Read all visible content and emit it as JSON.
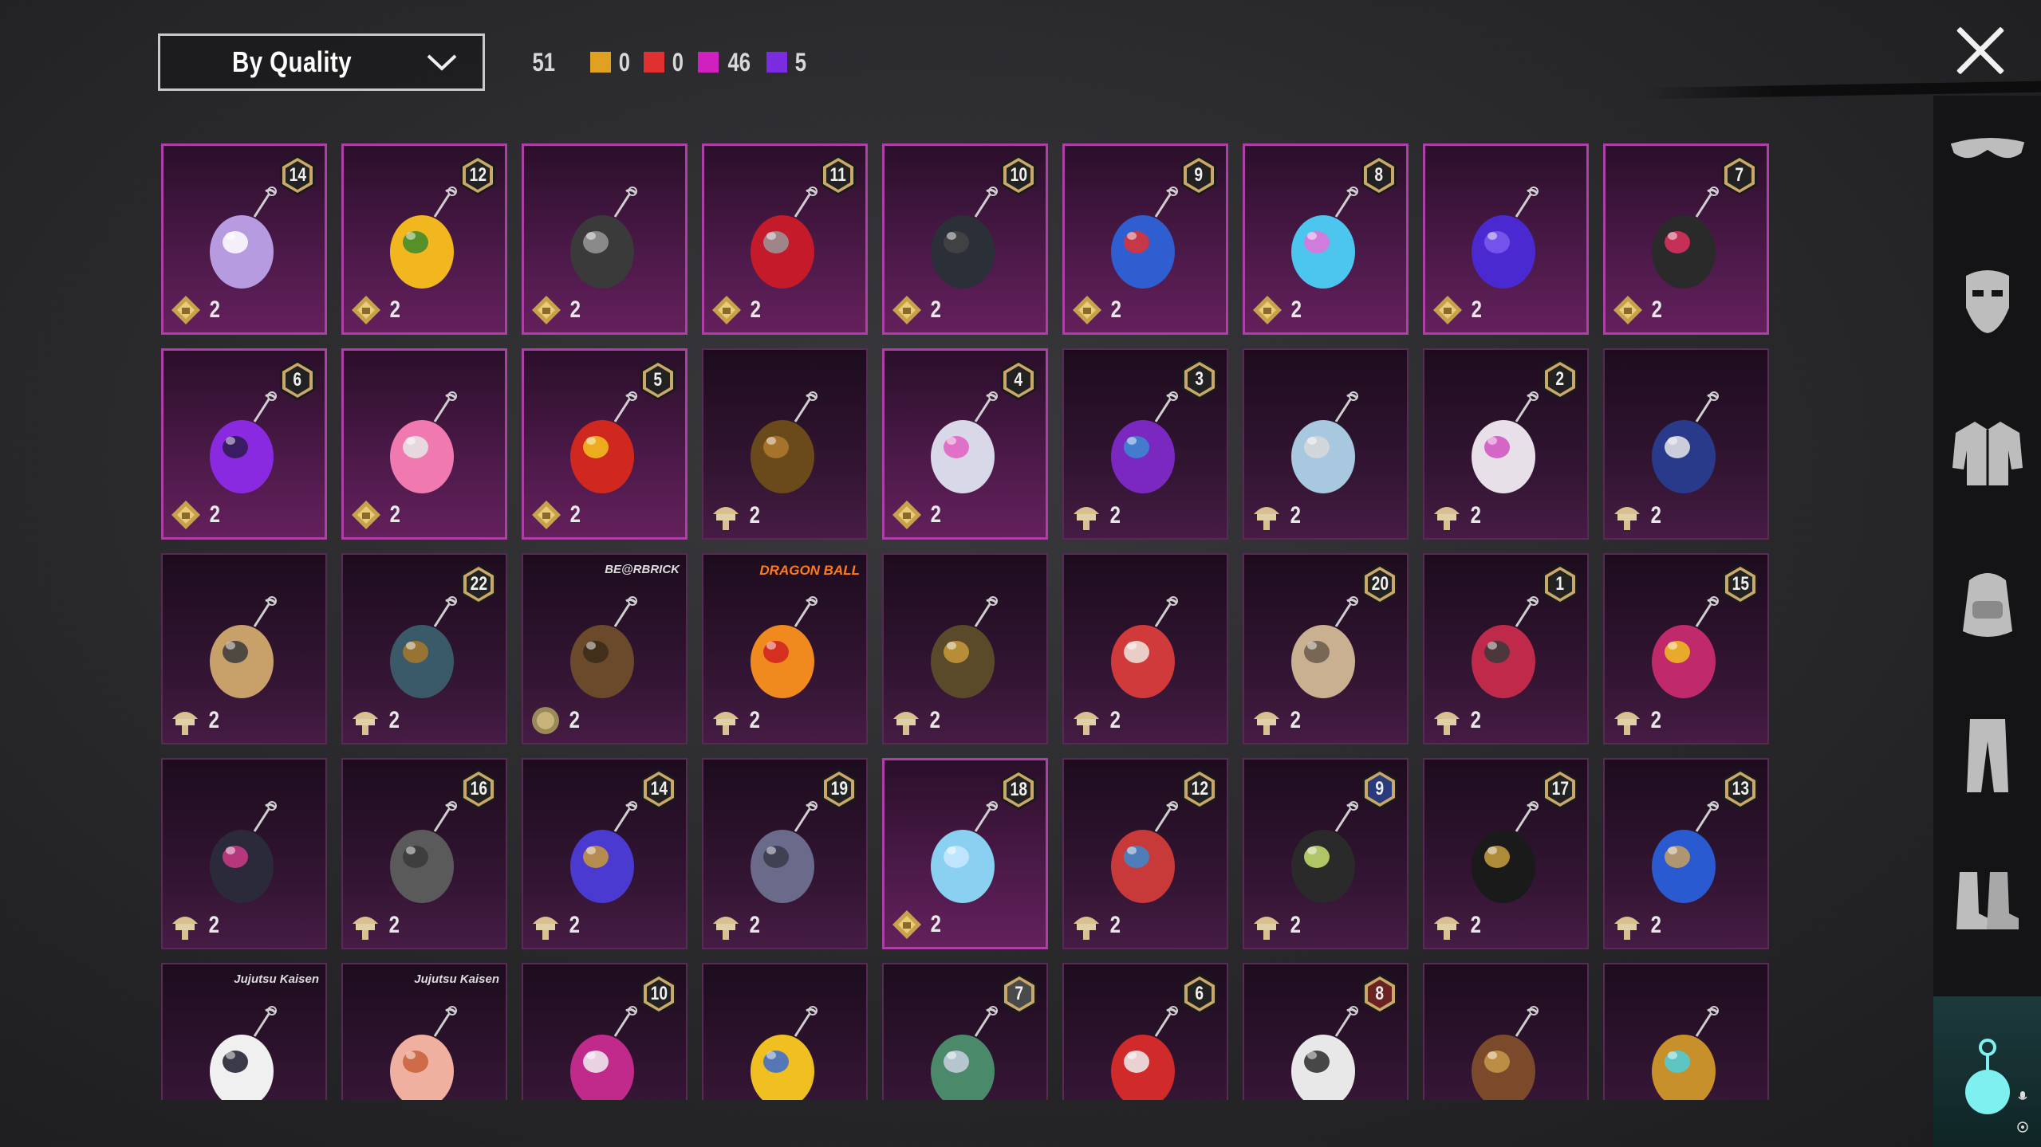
{
  "header": {
    "sort_label": "By Quality",
    "total": "51",
    "quality_counts": [
      {
        "color": "#e0a020",
        "count": "0"
      },
      {
        "color": "#e03030",
        "count": "0"
      },
      {
        "color": "#d020c0",
        "count": "46"
      },
      {
        "color": "#7a2de0",
        "count": "5"
      }
    ]
  },
  "sidebar": {
    "items": [
      "glasses-icon",
      "mask-icon",
      "jacket-icon",
      "backpack-icon",
      "pants-icon",
      "boots-icon"
    ],
    "active": "pendant-icon"
  },
  "cards": [
    {
      "rarity": "purple",
      "level": "14",
      "icon": "fluffy-cat-pendant",
      "cur": "gold",
      "qty": "2"
    },
    {
      "rarity": "purple",
      "level": "12",
      "icon": "sunflower-pendant",
      "cur": "gold",
      "qty": "2"
    },
    {
      "rarity": "purple",
      "level": "",
      "icon": "black-cat-pendant",
      "cur": "gold",
      "qty": "2"
    },
    {
      "rarity": "purple",
      "level": "11",
      "icon": "red-gem-pendant",
      "cur": "gold",
      "qty": "2"
    },
    {
      "rarity": "purple",
      "level": "10",
      "icon": "dark-cloak-pendant",
      "cur": "gold",
      "qty": "2"
    },
    {
      "rarity": "purple",
      "level": "9",
      "icon": "blue-gourd-pendant",
      "cur": "gold",
      "qty": "2"
    },
    {
      "rarity": "purple",
      "level": "8",
      "icon": "seahorse-pendant",
      "cur": "gold",
      "qty": "2"
    },
    {
      "rarity": "purple",
      "level": "",
      "icon": "purple-drill-pendant",
      "cur": "gold",
      "qty": "2"
    },
    {
      "rarity": "purple",
      "level": "7",
      "icon": "card-pendant",
      "cur": "gold",
      "qty": "2"
    },
    {
      "rarity": "purple",
      "level": "6",
      "icon": "dagger-pendant",
      "cur": "gold",
      "qty": "2"
    },
    {
      "rarity": "purple",
      "level": "",
      "icon": "flamingo-pendant",
      "cur": "gold",
      "qty": "2"
    },
    {
      "rarity": "purple",
      "level": "5",
      "icon": "firecracker-pendant",
      "cur": "gold",
      "qty": "2"
    },
    {
      "rarity": "dark",
      "level": "",
      "icon": "bell-pendant",
      "cur": "chest",
      "qty": "2"
    },
    {
      "rarity": "purple",
      "level": "4",
      "icon": "bunny-helmet-pendant",
      "cur": "gold",
      "qty": "2"
    },
    {
      "rarity": "dark",
      "level": "3",
      "icon": "disco-ball-pendant",
      "cur": "chest",
      "qty": "2"
    },
    {
      "rarity": "dark",
      "level": "",
      "icon": "pocket-watch-pendant",
      "cur": "chest",
      "qty": "2"
    },
    {
      "rarity": "dark",
      "level": "2",
      "icon": "unicorn-pendant",
      "cur": "chest",
      "qty": "2"
    },
    {
      "rarity": "dark",
      "level": "",
      "icon": "police-hat-pendant",
      "cur": "chest",
      "qty": "2"
    },
    {
      "rarity": "dark",
      "level": "",
      "icon": "horn-pendant",
      "cur": "chest",
      "qty": "2"
    },
    {
      "rarity": "dark",
      "level": "22",
      "icon": "compass-pendant",
      "cur": "chest",
      "qty": "2"
    },
    {
      "rarity": "dark",
      "level": "",
      "icon": "bearbrick-pendant",
      "cur": "coin",
      "qty": "2",
      "brand": "BE@RBRICK"
    },
    {
      "rarity": "dark",
      "level": "",
      "icon": "dragon-ball-pendant",
      "cur": "chest",
      "qty": "2",
      "brand": "DRAGON BALL"
    },
    {
      "rarity": "dark",
      "level": "",
      "icon": "ornate-key-pendant",
      "cur": "chest",
      "qty": "2"
    },
    {
      "rarity": "dark",
      "level": "",
      "icon": "lucky-cat-pendant",
      "cur": "chest",
      "qty": "2"
    },
    {
      "rarity": "dark",
      "level": "20",
      "icon": "crate-pendant",
      "cur": "chest",
      "qty": "2"
    },
    {
      "rarity": "dark",
      "level": "1",
      "icon": "robot-pendant",
      "cur": "chest",
      "qty": "2"
    },
    {
      "rarity": "dark",
      "level": "15",
      "icon": "jester-box-pendant",
      "cur": "chest",
      "qty": "2"
    },
    {
      "rarity": "dark",
      "level": "",
      "icon": "cube-pendant",
      "cur": "chest",
      "qty": "2"
    },
    {
      "rarity": "dark",
      "level": "16",
      "icon": "stone-figure-pendant",
      "cur": "chest",
      "qty": "2"
    },
    {
      "rarity": "dark",
      "level": "14",
      "icon": "bracelet-pendant",
      "cur": "chest",
      "qty": "2"
    },
    {
      "rarity": "dark",
      "level": "19",
      "icon": "octopus-pendant",
      "cur": "chest",
      "qty": "2"
    },
    {
      "rarity": "purple",
      "level": "18",
      "icon": "glass-slipper-pendant",
      "cur": "gold",
      "qty": "2"
    },
    {
      "rarity": "dark",
      "level": "12",
      "icon": "ufo-pendant",
      "cur": "chest",
      "qty": "2"
    },
    {
      "rarity": "dark",
      "level": "9",
      "icon": "mech-eye-pendant",
      "cur": "chest",
      "qty": "2",
      "lvlstyle": "blue"
    },
    {
      "rarity": "dark",
      "level": "17",
      "icon": "black-shield-pendant",
      "cur": "chest",
      "qty": "2"
    },
    {
      "rarity": "dark",
      "level": "13",
      "icon": "blue-scroll-pendant",
      "cur": "chest",
      "qty": "2"
    },
    {
      "rarity": "dark",
      "level": "",
      "icon": "gojo-pendant",
      "cur": "",
      "qty": "",
      "brand": "Jujutsu Kaisen"
    },
    {
      "rarity": "dark",
      "level": "",
      "icon": "yuji-pendant",
      "cur": "",
      "qty": "",
      "brand": "Jujutsu Kaisen"
    },
    {
      "rarity": "dark",
      "level": "10",
      "icon": "monster-mouth-pendant",
      "cur": "",
      "qty": ""
    },
    {
      "rarity": "dark",
      "level": "",
      "icon": "drum-pendant",
      "cur": "",
      "qty": ""
    },
    {
      "rarity": "dark",
      "level": "7",
      "icon": "winged-egg-pendant",
      "cur": "",
      "qty": "",
      "lvlstyle": "gray"
    },
    {
      "rarity": "dark",
      "level": "6",
      "icon": "gnome-pendant",
      "cur": "",
      "qty": ""
    },
    {
      "rarity": "dark",
      "level": "8",
      "icon": "cow-pendant",
      "cur": "",
      "qty": "",
      "lvlstyle": "red"
    },
    {
      "rarity": "dark",
      "level": "",
      "icon": "book-pendant",
      "cur": "",
      "qty": ""
    },
    {
      "rarity": "dark",
      "level": "",
      "icon": "beehive-pendant",
      "cur": "",
      "qty": ""
    }
  ]
}
